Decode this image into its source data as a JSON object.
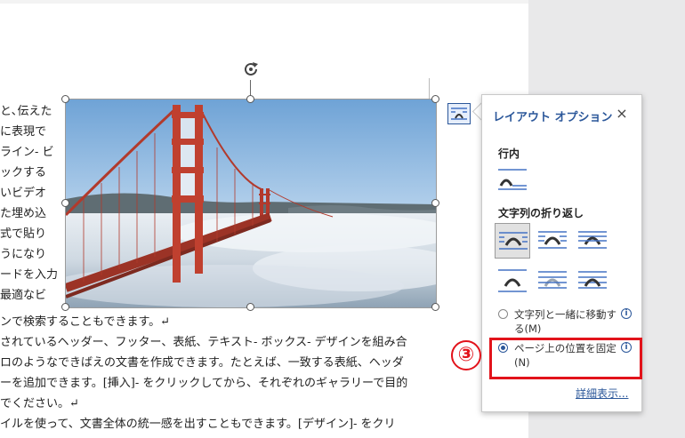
{
  "document": {
    "left_lines": [
      "と､伝えた",
      "に表現で",
      "ライン- ビ",
      "ックする",
      "いビデオ",
      "た埋め込",
      "式で貼り",
      "うになり",
      "ードを入力",
      "最適なビ"
    ],
    "full_lines": [
      "ンで検索することもできます。↵",
      "されているヘッダー、フッター、表紙、テキスト- ボックス- デザインを組み合",
      "ロのようなできばえの文書を作成できます。たとえば、一致する表紙、ヘッダ",
      "ーを追加できます。[挿入]- をクリックしてから、それぞれのギャラリーで目的",
      "でください。↵",
      "イルを使って、文書全体の統一感を出すこともできます。[デザイン]- をクリ"
    ]
  },
  "picture": {
    "subject": "Golden Gate Bridge above fog"
  },
  "layout_options": {
    "title": "レイアウト オプション",
    "close_icon": "×",
    "inline_label": "行内",
    "wrap_label": "文字列の折り返し",
    "radio_move": "文字列と一緒に移動する(M)",
    "radio_fix": "ページ上の位置を固定(N)",
    "radio_selected": "fix",
    "info_glyph": "i",
    "detail_link": "詳細表示..."
  },
  "annotation": {
    "step": "③",
    "color": "#e2131b"
  },
  "colors": {
    "accent": "#2b579a",
    "icon_blue": "#4472c4"
  }
}
